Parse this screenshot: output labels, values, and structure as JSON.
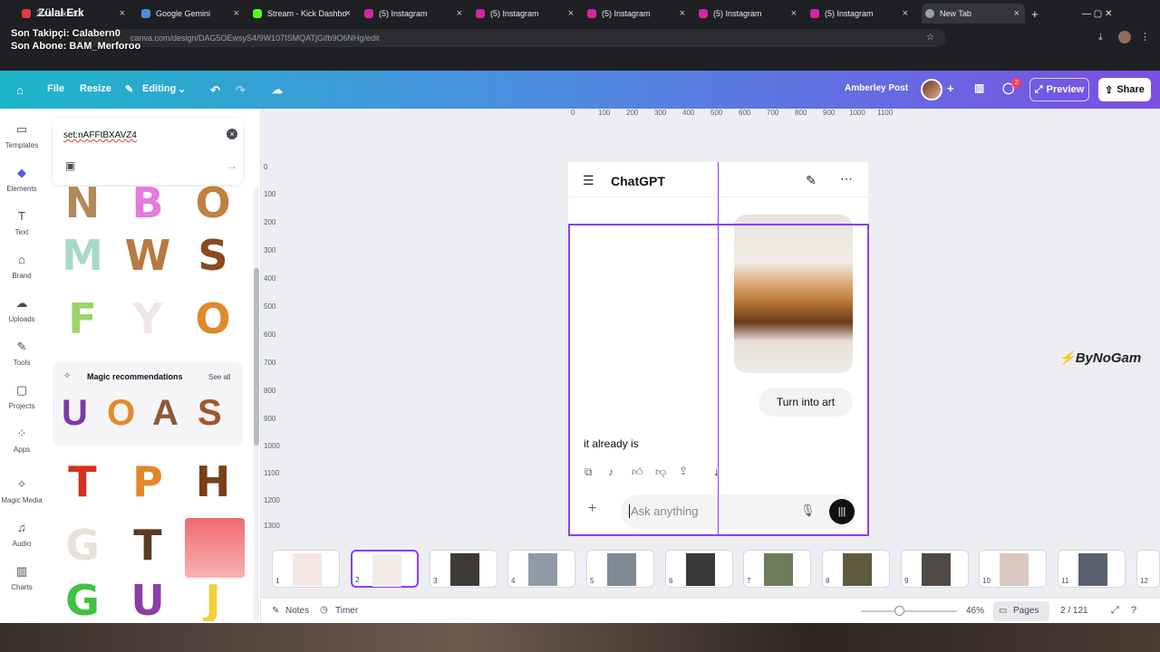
{
  "browser": {
    "tabs": [
      {
        "label": "Züla Erk Mul",
        "color": "#e23b3b"
      },
      {
        "label": "Google Gemini",
        "color": "#4b8ee0"
      },
      {
        "label": "Stream - Kick Dashbo",
        "color": "#53fc18"
      },
      {
        "label": "(5) Instagram",
        "color": "#d6249f"
      },
      {
        "label": "(5) Instagram",
        "color": "#d6249f"
      },
      {
        "label": "(5) Instagram",
        "color": "#d6249f"
      },
      {
        "label": "(5) Instagram",
        "color": "#d6249f"
      },
      {
        "label": "(5) Instagram",
        "color": "#d6249f"
      },
      {
        "label": "New Tab",
        "color": "#9aa0a6"
      }
    ],
    "url": "canva.com/design/DAG5OEwsyS4/9W107ISMQATjGifb9O6NHg/edit",
    "stream_overlay": {
      "line1": "Son Takipçi: Calabern0",
      "line2": "Son Abone: BAM_Merforoo"
    },
    "overlay_name": "Zülal Erk"
  },
  "header": {
    "file": "File",
    "resize": "Resize",
    "editing": "Editing",
    "user_name": "Amberley Post",
    "comments_badge": "2",
    "preview": "Preview",
    "share": "Share"
  },
  "rail": [
    {
      "label": "Templates",
      "icon": "templates-icon"
    },
    {
      "label": "Elements",
      "icon": "elements-icon"
    },
    {
      "label": "Text",
      "icon": "text-icon"
    },
    {
      "label": "Brand",
      "icon": "brand-icon"
    },
    {
      "label": "Uploads",
      "icon": "uploads-icon"
    },
    {
      "label": "Tools",
      "icon": "tools-icon"
    },
    {
      "label": "Projects",
      "icon": "projects-icon"
    },
    {
      "label": "Apps",
      "icon": "apps-icon"
    },
    {
      "label": "Magic Media",
      "icon": "magic-media-icon"
    },
    {
      "label": "Audio",
      "icon": "audio-icon"
    },
    {
      "label": "Charts",
      "icon": "charts-icon"
    }
  ],
  "panel": {
    "search_value": "set:nAFFtBXAVZ4",
    "magic_title": "Magic recommendations",
    "see_all": "See all",
    "letters_top": [
      "N",
      "B",
      "O",
      "M",
      "W",
      "S",
      "F",
      "Y",
      "O"
    ],
    "letters_magic": [
      "U",
      "O",
      "A",
      "S"
    ],
    "letters_bottom": [
      "T",
      "P",
      "H",
      "G",
      "T",
      "",
      "G",
      "U",
      "J"
    ]
  },
  "canvas": {
    "ruler_top": [
      "0",
      "100",
      "200",
      "300",
      "400",
      "500",
      "600",
      "700",
      "800",
      "900",
      "1000",
      "1100"
    ],
    "ruler_left": [
      "0",
      "100",
      "200",
      "300",
      "400",
      "500",
      "600",
      "700",
      "800",
      "900",
      "1000",
      "1100",
      "1200",
      "1300"
    ],
    "chat_title": "ChatGPT",
    "user_message": "Turn into art",
    "reply": "it already is",
    "ask_placeholder": "Ask anything",
    "watermark": "ByNoGam"
  },
  "thumbnails": [
    "1",
    "2",
    "3",
    "4",
    "5",
    "6",
    "7",
    "8",
    "9",
    "10",
    "11",
    "12"
  ],
  "footer": {
    "notes": "Notes",
    "timer": "Timer",
    "zoom": "46%",
    "pages": "Pages",
    "page_count": "2 / 121"
  }
}
